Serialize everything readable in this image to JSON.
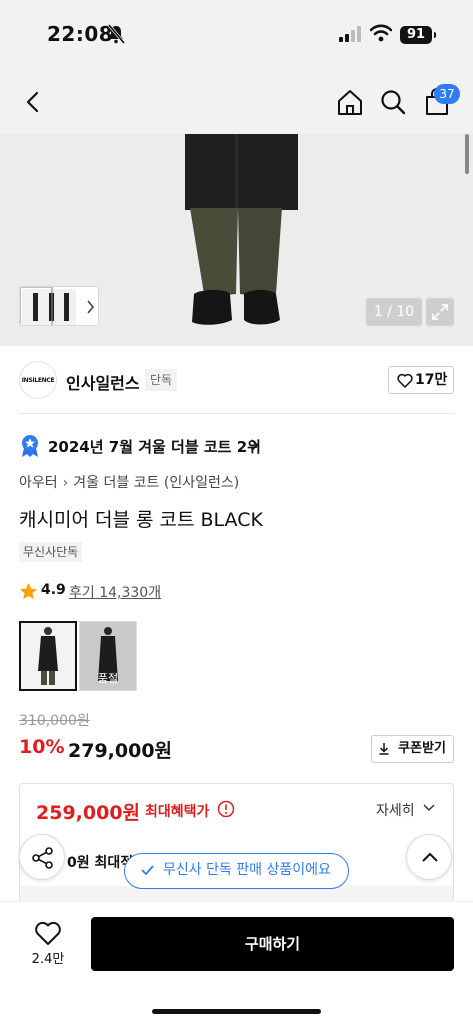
{
  "status_bar": {
    "time": "22:08",
    "battery": "91"
  },
  "nav": {
    "cart_count": "37"
  },
  "gallery": {
    "counter": "1 / 10"
  },
  "brand": {
    "logo_text": "INSILENCE",
    "name": "인사일런스",
    "exclusive_tag": "단독",
    "likes": "17만"
  },
  "ranking": {
    "text": "2024년 7월 겨울 더블 코트 2위"
  },
  "breadcrumb": {
    "level1": "아우터",
    "level2": "겨울 더블 코트 (인사일런스)"
  },
  "product": {
    "title": "캐시미어 더블 롱 코트 BLACK",
    "tag": "무신사단독",
    "rating": "4.9",
    "reviews_label": "후기 14,330개",
    "options": [
      {
        "sold_out_label": ""
      },
      {
        "sold_out_label": "품절"
      }
    ]
  },
  "pricing": {
    "original_price": "310,000원",
    "discount_rate": "10%",
    "sale_price": "279,000원",
    "coupon_label": "쿠폰받기",
    "max_benefit_price": "259,000원",
    "max_benefit_label": "최대혜택가",
    "detail_label": "자세히",
    "row2_text": "0원 최대적"
  },
  "banner": {
    "text": "무신사 단독 판매 상품이에요"
  },
  "bottom": {
    "likes": "2.4만",
    "buy_label": "구매하기"
  },
  "colors": {
    "accent_blue": "#2f7df6",
    "discount_red": "#e01e1e",
    "buy_black": "#000000"
  }
}
